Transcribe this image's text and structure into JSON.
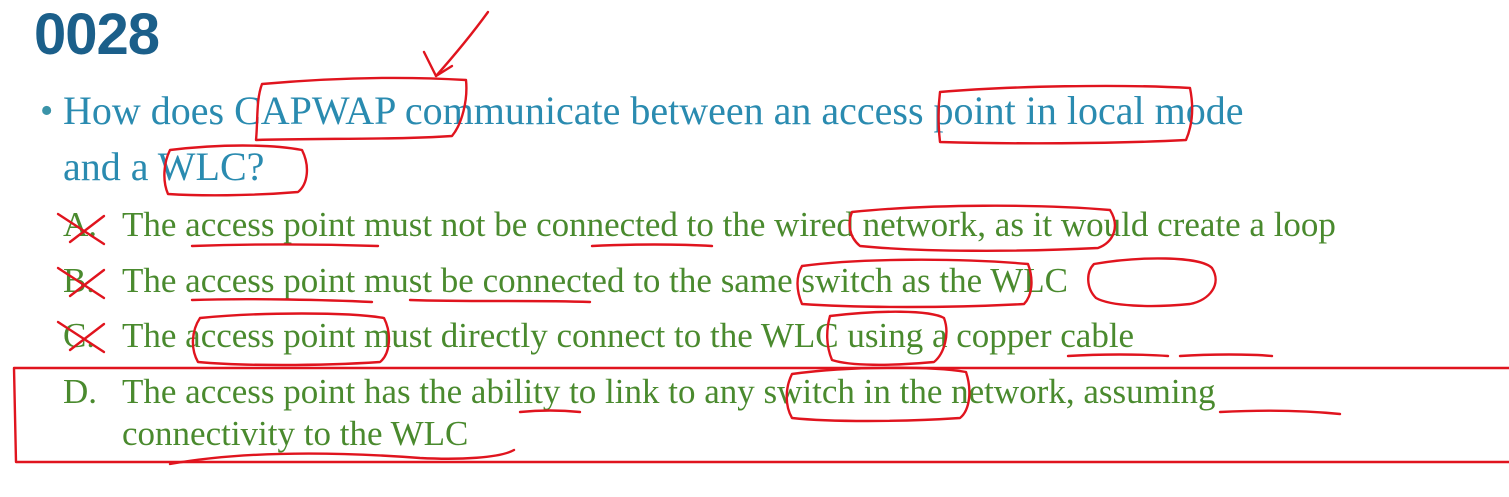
{
  "slide": {
    "number": "0028",
    "question": {
      "bullet": "•",
      "line1": "How does CAPWAP communicate between an access point in local mode",
      "line2": "and a WLC?"
    },
    "options": [
      {
        "letter": "A.",
        "text": "The access point must not be connected to the wired network, as it would create a loop"
      },
      {
        "letter": "B.",
        "text": "The access point must be connected to the same switch as the WLC"
      },
      {
        "letter": "C.",
        "text": "The access point must directly connect to the WLC using a copper cable"
      },
      {
        "letter": "D.",
        "text_line1": "The access point has the ability to link to any switch in the network, assuming",
        "text_line2": "connectivity to the WLC"
      }
    ]
  },
  "annotation": {
    "color": "#e0141e",
    "correct_option": "D."
  }
}
